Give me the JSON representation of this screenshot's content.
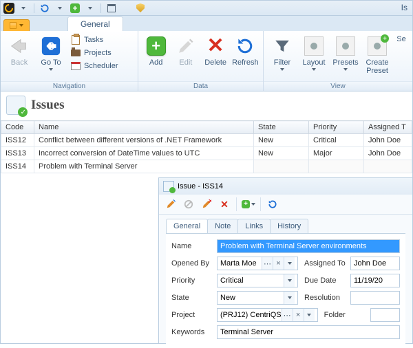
{
  "app_title": "Is",
  "ribbon": {
    "tab": "General",
    "groups": {
      "navigation": {
        "label": "Navigation",
        "back": "Back",
        "goto": "Go To",
        "tasks": "Tasks",
        "projects": "Projects",
        "scheduler": "Scheduler"
      },
      "data": {
        "label": "Data",
        "add": "Add",
        "edit": "Edit",
        "delete": "Delete",
        "refresh": "Refresh"
      },
      "view": {
        "label": "View",
        "filter": "Filter",
        "layout": "Layout",
        "presets": "Presets",
        "create_preset_l1": "Create",
        "create_preset_l2": "Preset",
        "settings": "Se"
      }
    }
  },
  "page": {
    "title": "Issues"
  },
  "columns": [
    "Code",
    "Name",
    "State",
    "Priority",
    "Assigned T"
  ],
  "rows": [
    {
      "code": "ISS12",
      "name": "Conflict between different versions of .NET Framework",
      "state": "New",
      "priority": "Critical",
      "assigned": "John Doe"
    },
    {
      "code": "ISS13",
      "name": "Incorrect conversion of DateTime values to UTC",
      "state": "New",
      "priority": "Major",
      "assigned": "John Doe"
    },
    {
      "code": "ISS14",
      "name": "Problem with Terminal Server",
      "state": "",
      "priority": "",
      "assigned": ""
    }
  ],
  "detail": {
    "title": "Issue - ISS14",
    "tabs": [
      "General",
      "Note",
      "Links",
      "History"
    ],
    "fields": {
      "name_lbl": "Name",
      "name_val": "Problem with Terminal Server environments",
      "opened_lbl": "Opened By",
      "opened_val": "Marta Moe",
      "assigned_lbl": "Assigned To",
      "assigned_val": "John Doe",
      "priority_lbl": "Priority",
      "priority_val": "Critical",
      "due_lbl": "Due Date",
      "due_val": "11/19/20",
      "state_lbl": "State",
      "state_val": "New",
      "resolution_lbl": "Resolution",
      "resolution_val": "",
      "project_lbl": "Project",
      "project_val": "(PRJ12) CentriQS",
      "folder_lbl": "Folder",
      "folder_val": "",
      "keywords_lbl": "Keywords",
      "keywords_val": "Terminal Server"
    }
  }
}
